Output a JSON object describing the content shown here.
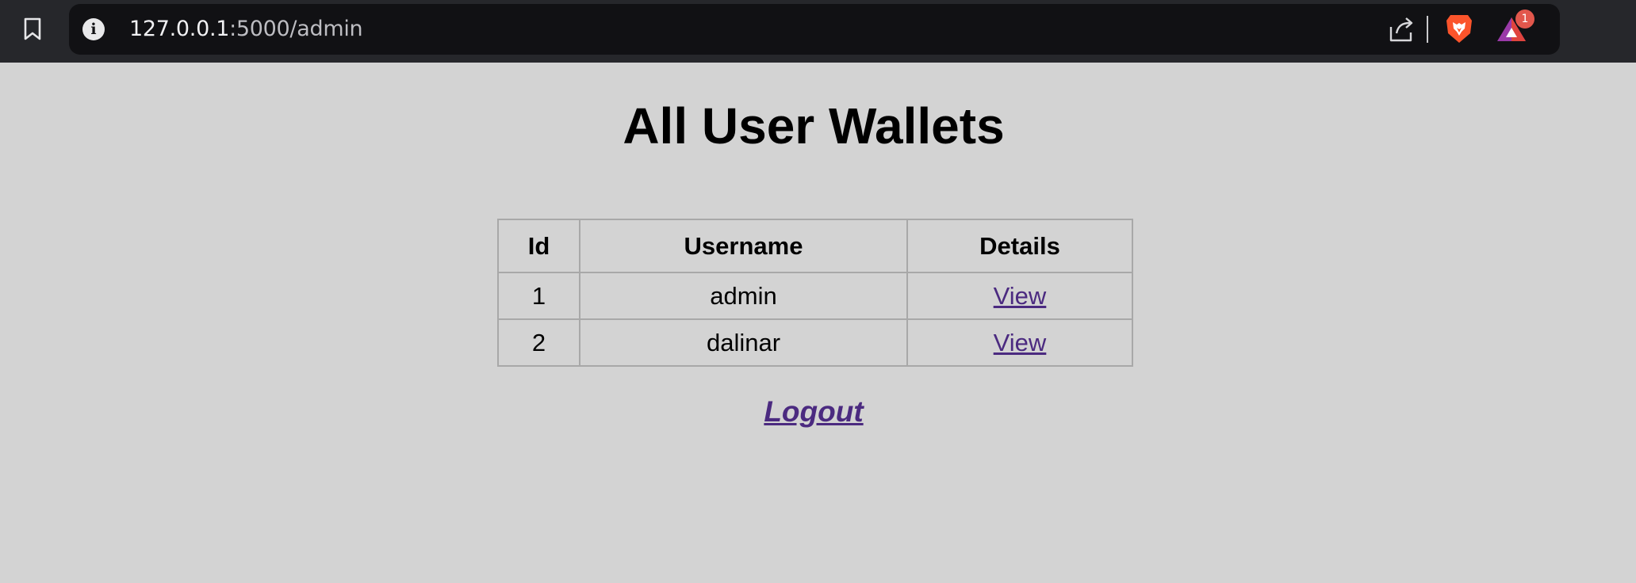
{
  "browser": {
    "url_host": "127.0.0.1",
    "url_path": ":5000/admin",
    "rewards_badge_count": "1",
    "icons": [
      "bookmark-icon",
      "info-icon",
      "share-icon",
      "brave-lion-icon",
      "brave-rewards-icon"
    ],
    "colors": {
      "toolbar": "#26272b",
      "omnibox": "#111114",
      "brave_orange": "#fb542b",
      "badge": "#e2574c"
    }
  },
  "page": {
    "title": "All User Wallets",
    "background": "#d3d3d3",
    "link_color": "#4b2a80"
  },
  "table": {
    "headers": {
      "id": "Id",
      "username": "Username",
      "details": "Details"
    },
    "rows": [
      {
        "id": "1",
        "username": "admin",
        "details": "View"
      },
      {
        "id": "2",
        "username": "dalinar",
        "details": "View"
      }
    ]
  },
  "logout": {
    "label": "Logout"
  }
}
